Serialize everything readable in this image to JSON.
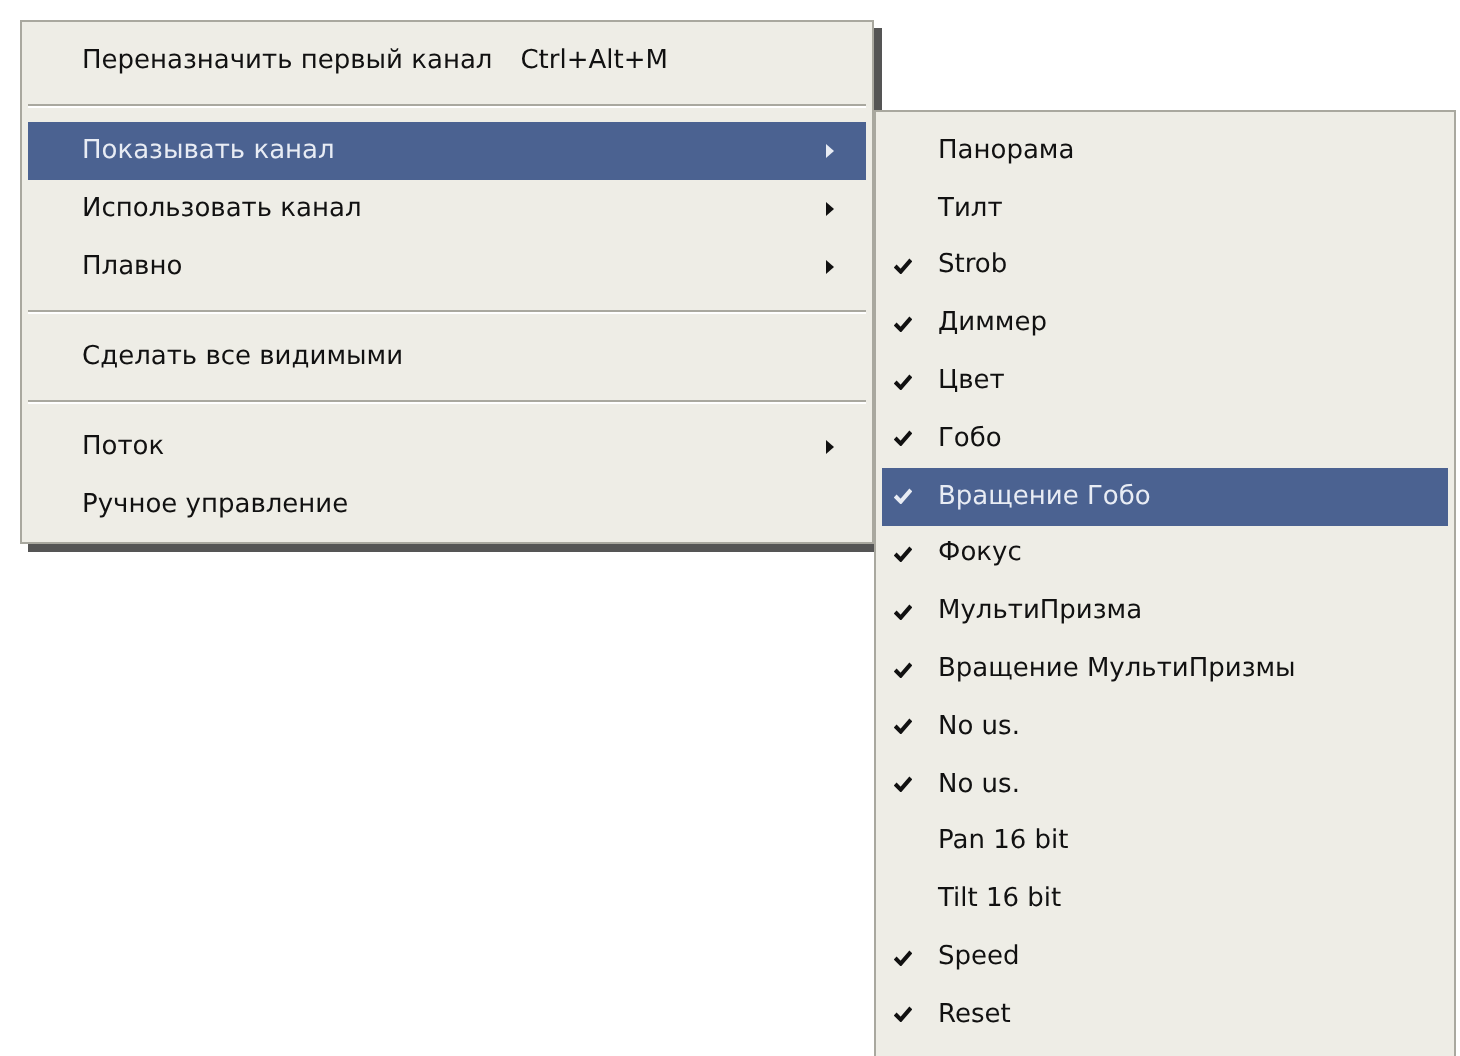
{
  "menu": {
    "items": [
      {
        "kind": "item",
        "label": "Переназначить первый канал",
        "shortcut": "Ctrl+Alt+M",
        "selected": false,
        "has_submenu": false
      },
      {
        "kind": "separator"
      },
      {
        "kind": "item",
        "label": "Показывать канал",
        "selected": true,
        "has_submenu": true
      },
      {
        "kind": "item",
        "label": "Использовать канал",
        "selected": false,
        "has_submenu": true
      },
      {
        "kind": "item",
        "label": "Плавно",
        "selected": false,
        "has_submenu": true
      },
      {
        "kind": "separator"
      },
      {
        "kind": "item",
        "label": "Сделать все видимыми",
        "selected": false,
        "has_submenu": false
      },
      {
        "kind": "separator"
      },
      {
        "kind": "item",
        "label": "Поток",
        "selected": false,
        "has_submenu": true
      },
      {
        "kind": "item",
        "label": "Ручное управление",
        "selected": false,
        "has_submenu": false
      }
    ]
  },
  "submenu": {
    "items": [
      {
        "label": "Панорама",
        "checked": false,
        "selected": false
      },
      {
        "label": "Тилт",
        "checked": false,
        "selected": false
      },
      {
        "label": "Strob",
        "checked": true,
        "selected": false
      },
      {
        "label": "Диммер",
        "checked": true,
        "selected": false
      },
      {
        "label": "Цвет",
        "checked": true,
        "selected": false
      },
      {
        "label": "Гобо",
        "checked": true,
        "selected": false
      },
      {
        "label": "Вращение Гобо",
        "checked": true,
        "selected": true
      },
      {
        "label": "Фокус",
        "checked": true,
        "selected": false
      },
      {
        "label": "МультиПризма",
        "checked": true,
        "selected": false
      },
      {
        "label": "Вращение МультиПризмы",
        "checked": true,
        "selected": false
      },
      {
        "label": "No us.",
        "checked": true,
        "selected": false
      },
      {
        "label": "No us.",
        "checked": true,
        "selected": false
      },
      {
        "label": "Pan 16 bit",
        "checked": false,
        "selected": false
      },
      {
        "label": "Tilt 16 bit",
        "checked": false,
        "selected": false
      },
      {
        "label": "Speed",
        "checked": true,
        "selected": false
      },
      {
        "label": "Reset",
        "checked": true,
        "selected": false
      }
    ]
  }
}
